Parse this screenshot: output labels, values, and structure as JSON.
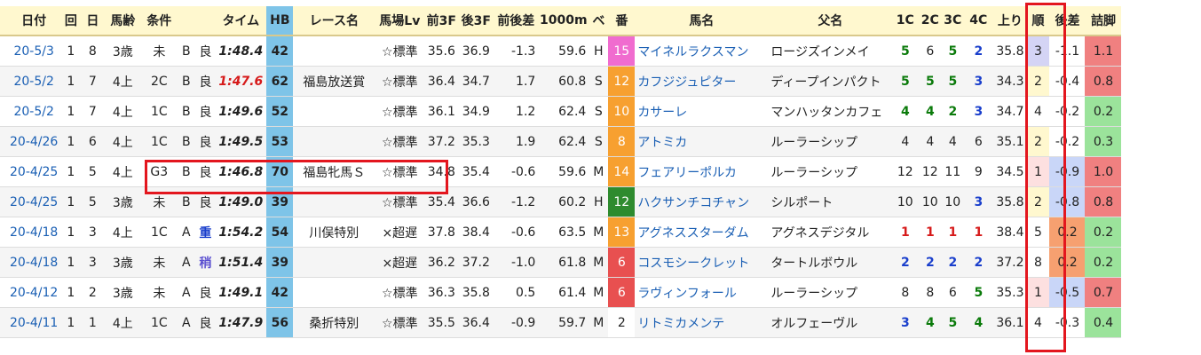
{
  "headers": [
    "゛",
    "日付",
    "回",
    "日",
    "馬齢",
    "条件",
    "",
    "",
    "タイム",
    "HB",
    "レース名",
    "馬場Lv",
    "前3F",
    "後3F",
    "前後差",
    "1000m",
    "ベ",
    "番",
    "馬名",
    "父名",
    "1C",
    "2C",
    "3C",
    "4C",
    "上り",
    "順",
    "後差",
    "詰脚"
  ],
  "rows": [
    {
      "date": "20-5/3",
      "kai": "1",
      "day": "8",
      "age": "3歳",
      "cond": "未",
      "cls": "B",
      "baba": "良",
      "time": "1:48.4",
      "time_fast": false,
      "hb": "42",
      "race": "",
      "lv": "☆標準",
      "f3": "35.6",
      "l3": "36.9",
      "diff": "-1.3",
      "m1000": "59.6",
      "be": "H",
      "ban": "15",
      "ban_bg": "#f06ccf",
      "horse": "マイネルラクスマン",
      "sire": "ロージズインメイ",
      "c1": "5",
      "c1c": "c-g",
      "c2": "6",
      "c2c": "c-k",
      "c3": "5",
      "c3c": "c-g",
      "c4": "2",
      "c4c": "c-b",
      "agari": "35.8",
      "jun": "3",
      "jun_bg": "#d4d4f5",
      "gosa": "-1.1",
      "gosa_bg": "#ffffff",
      "tsume": "1.1",
      "tsume_bg": "#f08080"
    },
    {
      "date": "20-5/2",
      "kai": "1",
      "day": "7",
      "age": "4上",
      "cond": "2C",
      "cls": "B",
      "baba": "良",
      "time": "1:47.6",
      "time_fast": true,
      "hb": "62",
      "race": "福島放送賞",
      "lv": "☆標準",
      "f3": "36.4",
      "l3": "34.7",
      "diff": "1.7",
      "m1000": "60.8",
      "be": "S",
      "ban": "12",
      "ban_bg": "#f7a030",
      "horse": "カフジジュピター",
      "sire": "ディープインパクト",
      "c1": "5",
      "c1c": "c-g",
      "c2": "5",
      "c2c": "c-g",
      "c3": "5",
      "c3c": "c-g",
      "c4": "3",
      "c4c": "c-b",
      "agari": "34.3",
      "jun": "2",
      "jun_bg": "#fff8cf",
      "gosa": "-0.4",
      "gosa_bg": "#ffffff",
      "tsume": "0.8",
      "tsume_bg": "#f08080"
    },
    {
      "date": "20-5/2",
      "kai": "1",
      "day": "7",
      "age": "4上",
      "cond": "1C",
      "cls": "B",
      "baba": "良",
      "time": "1:49.6",
      "time_fast": false,
      "hb": "52",
      "race": "",
      "lv": "☆標準",
      "f3": "36.1",
      "l3": "34.9",
      "diff": "1.2",
      "m1000": "62.4",
      "be": "S",
      "ban": "10",
      "ban_bg": "#f7a030",
      "horse": "カサーレ",
      "sire": "マンハッタンカフェ",
      "c1": "4",
      "c1c": "c-g",
      "c2": "4",
      "c2c": "c-g",
      "c3": "2",
      "c3c": "c-g",
      "c4": "3",
      "c4c": "c-b",
      "agari": "34.7",
      "jun": "4",
      "jun_bg": "#ffffff",
      "gosa": "-0.2",
      "gosa_bg": "#ffffff",
      "tsume": "0.2",
      "tsume_bg": "#9be39b"
    },
    {
      "date": "20-4/26",
      "kai": "1",
      "day": "6",
      "age": "4上",
      "cond": "1C",
      "cls": "B",
      "baba": "良",
      "time": "1:49.5",
      "time_fast": false,
      "hb": "53",
      "race": "",
      "lv": "☆標準",
      "f3": "37.2",
      "l3": "35.3",
      "diff": "1.9",
      "m1000": "62.4",
      "be": "S",
      "ban": "8",
      "ban_bg": "#f7a030",
      "horse": "アトミカ",
      "sire": "ルーラーシップ",
      "c1": "4",
      "c1c": "c-k",
      "c2": "4",
      "c2c": "c-k",
      "c3": "4",
      "c3c": "c-k",
      "c4": "6",
      "c4c": "c-k",
      "agari": "35.1",
      "jun": "2",
      "jun_bg": "#fff8cf",
      "gosa": "-0.2",
      "gosa_bg": "#ffffff",
      "tsume": "0.3",
      "tsume_bg": "#9be39b"
    },
    {
      "date": "20-4/25",
      "kai": "1",
      "day": "5",
      "age": "4上",
      "cond": "G3",
      "cls": "B",
      "baba": "良",
      "time": "1:46.8",
      "time_fast": false,
      "hb": "70",
      "race": "福島牝馬Ｓ",
      "lv": "☆標準",
      "f3": "34.8",
      "l3": "35.4",
      "diff": "-0.6",
      "m1000": "59.6",
      "be": "M",
      "ban": "14",
      "ban_bg": "#f7a030",
      "horse": "フェアリーポルカ",
      "sire": "ルーラーシップ",
      "c1": "12",
      "c1c": "c-k",
      "c2": "12",
      "c2c": "c-k",
      "c3": "11",
      "c3c": "c-k",
      "c4": "9",
      "c4c": "c-k",
      "agari": "34.5",
      "jun": "1",
      "jun_bg": "#fde0e0",
      "gosa": "-0.9",
      "gosa_bg": "#c9d6f8",
      "tsume": "1.0",
      "tsume_bg": "#f08080"
    },
    {
      "date": "20-4/25",
      "kai": "1",
      "day": "5",
      "age": "3歳",
      "cond": "未",
      "cls": "B",
      "baba": "良",
      "time": "1:49.0",
      "time_fast": false,
      "hb": "39",
      "race": "",
      "lv": "☆標準",
      "f3": "35.4",
      "l3": "36.6",
      "diff": "-1.2",
      "m1000": "60.2",
      "be": "H",
      "ban": "12",
      "ban_bg": "#2e8b2e",
      "horse": "ハクサンチコチャン",
      "sire": "シルポート",
      "c1": "10",
      "c1c": "c-k",
      "c2": "10",
      "c2c": "c-k",
      "c3": "10",
      "c3c": "c-k",
      "c4": "3",
      "c4c": "c-b",
      "agari": "35.8",
      "jun": "2",
      "jun_bg": "#fff8cf",
      "gosa": "-0.8",
      "gosa_bg": "#c9d6f8",
      "tsume": "0.8",
      "tsume_bg": "#f08080"
    },
    {
      "date": "20-4/18",
      "kai": "1",
      "day": "3",
      "age": "4上",
      "cond": "1C",
      "cls": "A",
      "baba": "重",
      "time": "1:54.2",
      "time_fast": false,
      "hb": "54",
      "race": "川俣特別",
      "lv": "×超遅",
      "f3": "37.8",
      "l3": "38.4",
      "diff": "-0.6",
      "m1000": "63.5",
      "be": "M",
      "ban": "13",
      "ban_bg": "#f7a030",
      "horse": "アグネススターダム",
      "sire": "アグネスデジタル",
      "c1": "1",
      "c1c": "c-r",
      "c2": "1",
      "c2c": "c-r",
      "c3": "1",
      "c3c": "c-r",
      "c4": "1",
      "c4c": "c-r",
      "agari": "38.4",
      "jun": "5",
      "jun_bg": "#ffffff",
      "gosa": "0.2",
      "gosa_bg": "#f6a070",
      "tsume": "0.2",
      "tsume_bg": "#9be39b"
    },
    {
      "date": "20-4/18",
      "kai": "1",
      "day": "3",
      "age": "3歳",
      "cond": "未",
      "cls": "A",
      "baba": "稍",
      "time": "1:51.4",
      "time_fast": false,
      "hb": "39",
      "race": "",
      "lv": "×超遅",
      "f3": "36.2",
      "l3": "37.2",
      "diff": "-1.0",
      "m1000": "61.8",
      "be": "M",
      "ban": "6",
      "ban_bg": "#e85050",
      "horse": "コスモシークレット",
      "sire": "タートルボウル",
      "c1": "2",
      "c1c": "c-b",
      "c2": "2",
      "c2c": "c-b",
      "c3": "2",
      "c3c": "c-b",
      "c4": "2",
      "c4c": "c-b",
      "agari": "37.2",
      "jun": "8",
      "jun_bg": "#ffffff",
      "gosa": "0.2",
      "gosa_bg": "#f6a070",
      "tsume": "0.2",
      "tsume_bg": "#9be39b"
    },
    {
      "date": "20-4/12",
      "kai": "1",
      "day": "2",
      "age": "3歳",
      "cond": "未",
      "cls": "A",
      "baba": "良",
      "time": "1:49.1",
      "time_fast": false,
      "hb": "42",
      "race": "",
      "lv": "☆標準",
      "f3": "36.3",
      "l3": "35.8",
      "diff": "0.5",
      "m1000": "61.4",
      "be": "M",
      "ban": "6",
      "ban_bg": "#e85050",
      "horse": "ラヴィンフォール",
      "sire": "ルーラーシップ",
      "c1": "8",
      "c1c": "c-k",
      "c2": "8",
      "c2c": "c-k",
      "c3": "6",
      "c3c": "c-k",
      "c4": "5",
      "c4c": "c-g",
      "agari": "35.3",
      "jun": "1",
      "jun_bg": "#fde0e0",
      "gosa": "-0.5",
      "gosa_bg": "#c9d6f8",
      "tsume": "0.7",
      "tsume_bg": "#f08080"
    },
    {
      "date": "20-4/11",
      "kai": "1",
      "day": "1",
      "age": "4上",
      "cond": "1C",
      "cls": "A",
      "baba": "良",
      "time": "1:47.9",
      "time_fast": false,
      "hb": "56",
      "race": "桑折特別",
      "lv": "☆標準",
      "f3": "35.5",
      "l3": "36.4",
      "diff": "-0.9",
      "m1000": "59.7",
      "be": "M",
      "ban": "2",
      "ban_bg": "#ffffff",
      "horse": "リトミカメンテ",
      "sire": "オルフェーヴル",
      "c1": "3",
      "c1c": "c-b",
      "c2": "4",
      "c2c": "c-g",
      "c3": "5",
      "c3c": "c-g",
      "c4": "4",
      "c4c": "c-g",
      "agari": "36.1",
      "jun": "4",
      "jun_bg": "#ffffff",
      "gosa": "-0.3",
      "gosa_bg": "#ffffff",
      "tsume": "0.4",
      "tsume_bg": "#9be39b"
    }
  ]
}
